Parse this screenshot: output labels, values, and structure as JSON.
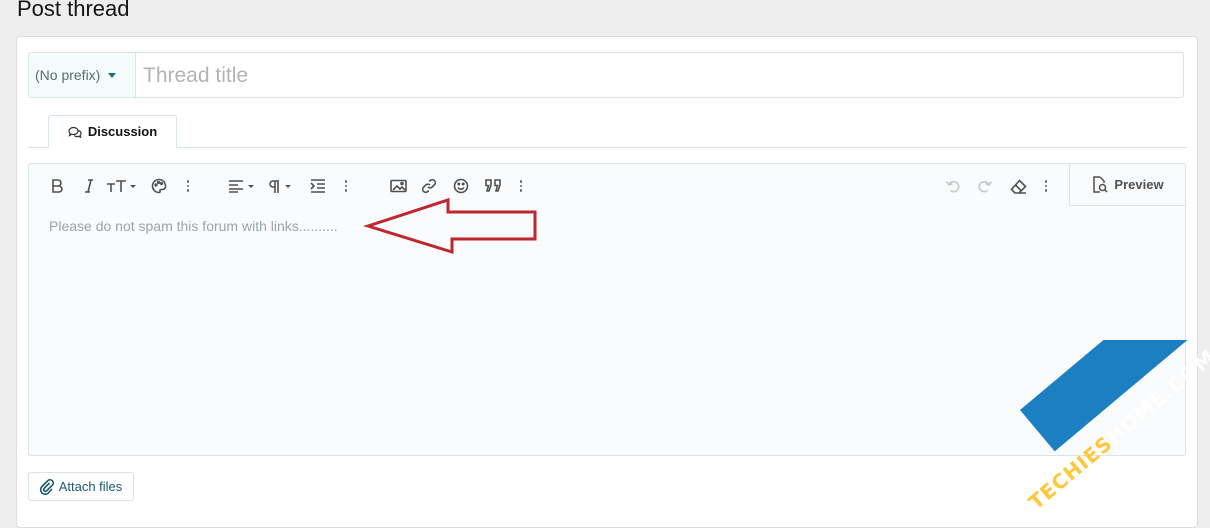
{
  "page": {
    "title": "Post thread"
  },
  "form": {
    "prefix_label": "(No prefix)",
    "title_placeholder": "Thread title",
    "title_value": ""
  },
  "tabs": [
    {
      "label": "Discussion",
      "icon": "comments-icon",
      "active": true
    }
  ],
  "editor": {
    "toolbar": {
      "left": [
        {
          "name": "bold",
          "icon": "bold-icon"
        },
        {
          "name": "italic",
          "icon": "italic-icon"
        },
        {
          "name": "font-size",
          "icon": "text-size-icon"
        },
        {
          "name": "text-color",
          "icon": "palette-icon"
        },
        {
          "name": "more-text",
          "icon": "vertical-dots-icon"
        },
        {
          "name": "align",
          "icon": "align-left-icon"
        },
        {
          "name": "paragraph",
          "icon": "paragraph-icon"
        },
        {
          "name": "indent",
          "icon": "indent-icon"
        },
        {
          "name": "more-paragraph",
          "icon": "vertical-dots-icon"
        },
        {
          "name": "insert-image",
          "icon": "image-icon"
        },
        {
          "name": "insert-link",
          "icon": "link-icon"
        },
        {
          "name": "emoji",
          "icon": "smiley-icon"
        },
        {
          "name": "quote",
          "icon": "quote-icon"
        },
        {
          "name": "more-insert",
          "icon": "vertical-dots-icon"
        }
      ],
      "right": [
        {
          "name": "undo",
          "icon": "undo-icon",
          "disabled": true
        },
        {
          "name": "redo",
          "icon": "redo-icon",
          "disabled": true
        },
        {
          "name": "clear-formatting",
          "icon": "eraser-icon"
        },
        {
          "name": "more-misc",
          "icon": "vertical-dots-icon"
        }
      ],
      "preview_label": "Preview"
    },
    "placeholder": "Please do not spam this forum with links.........."
  },
  "attach": {
    "label": "Attach files"
  },
  "watermark": {
    "text_a": "TECHIES",
    "text_b": "HOME.COM"
  },
  "colors": {
    "accent": "#1c5a6e",
    "border": "#d8e3e3",
    "annotation_arrow": "#c0262d",
    "watermark_band": "#1b7fc1",
    "watermark_yellow": "#ffc83d"
  }
}
